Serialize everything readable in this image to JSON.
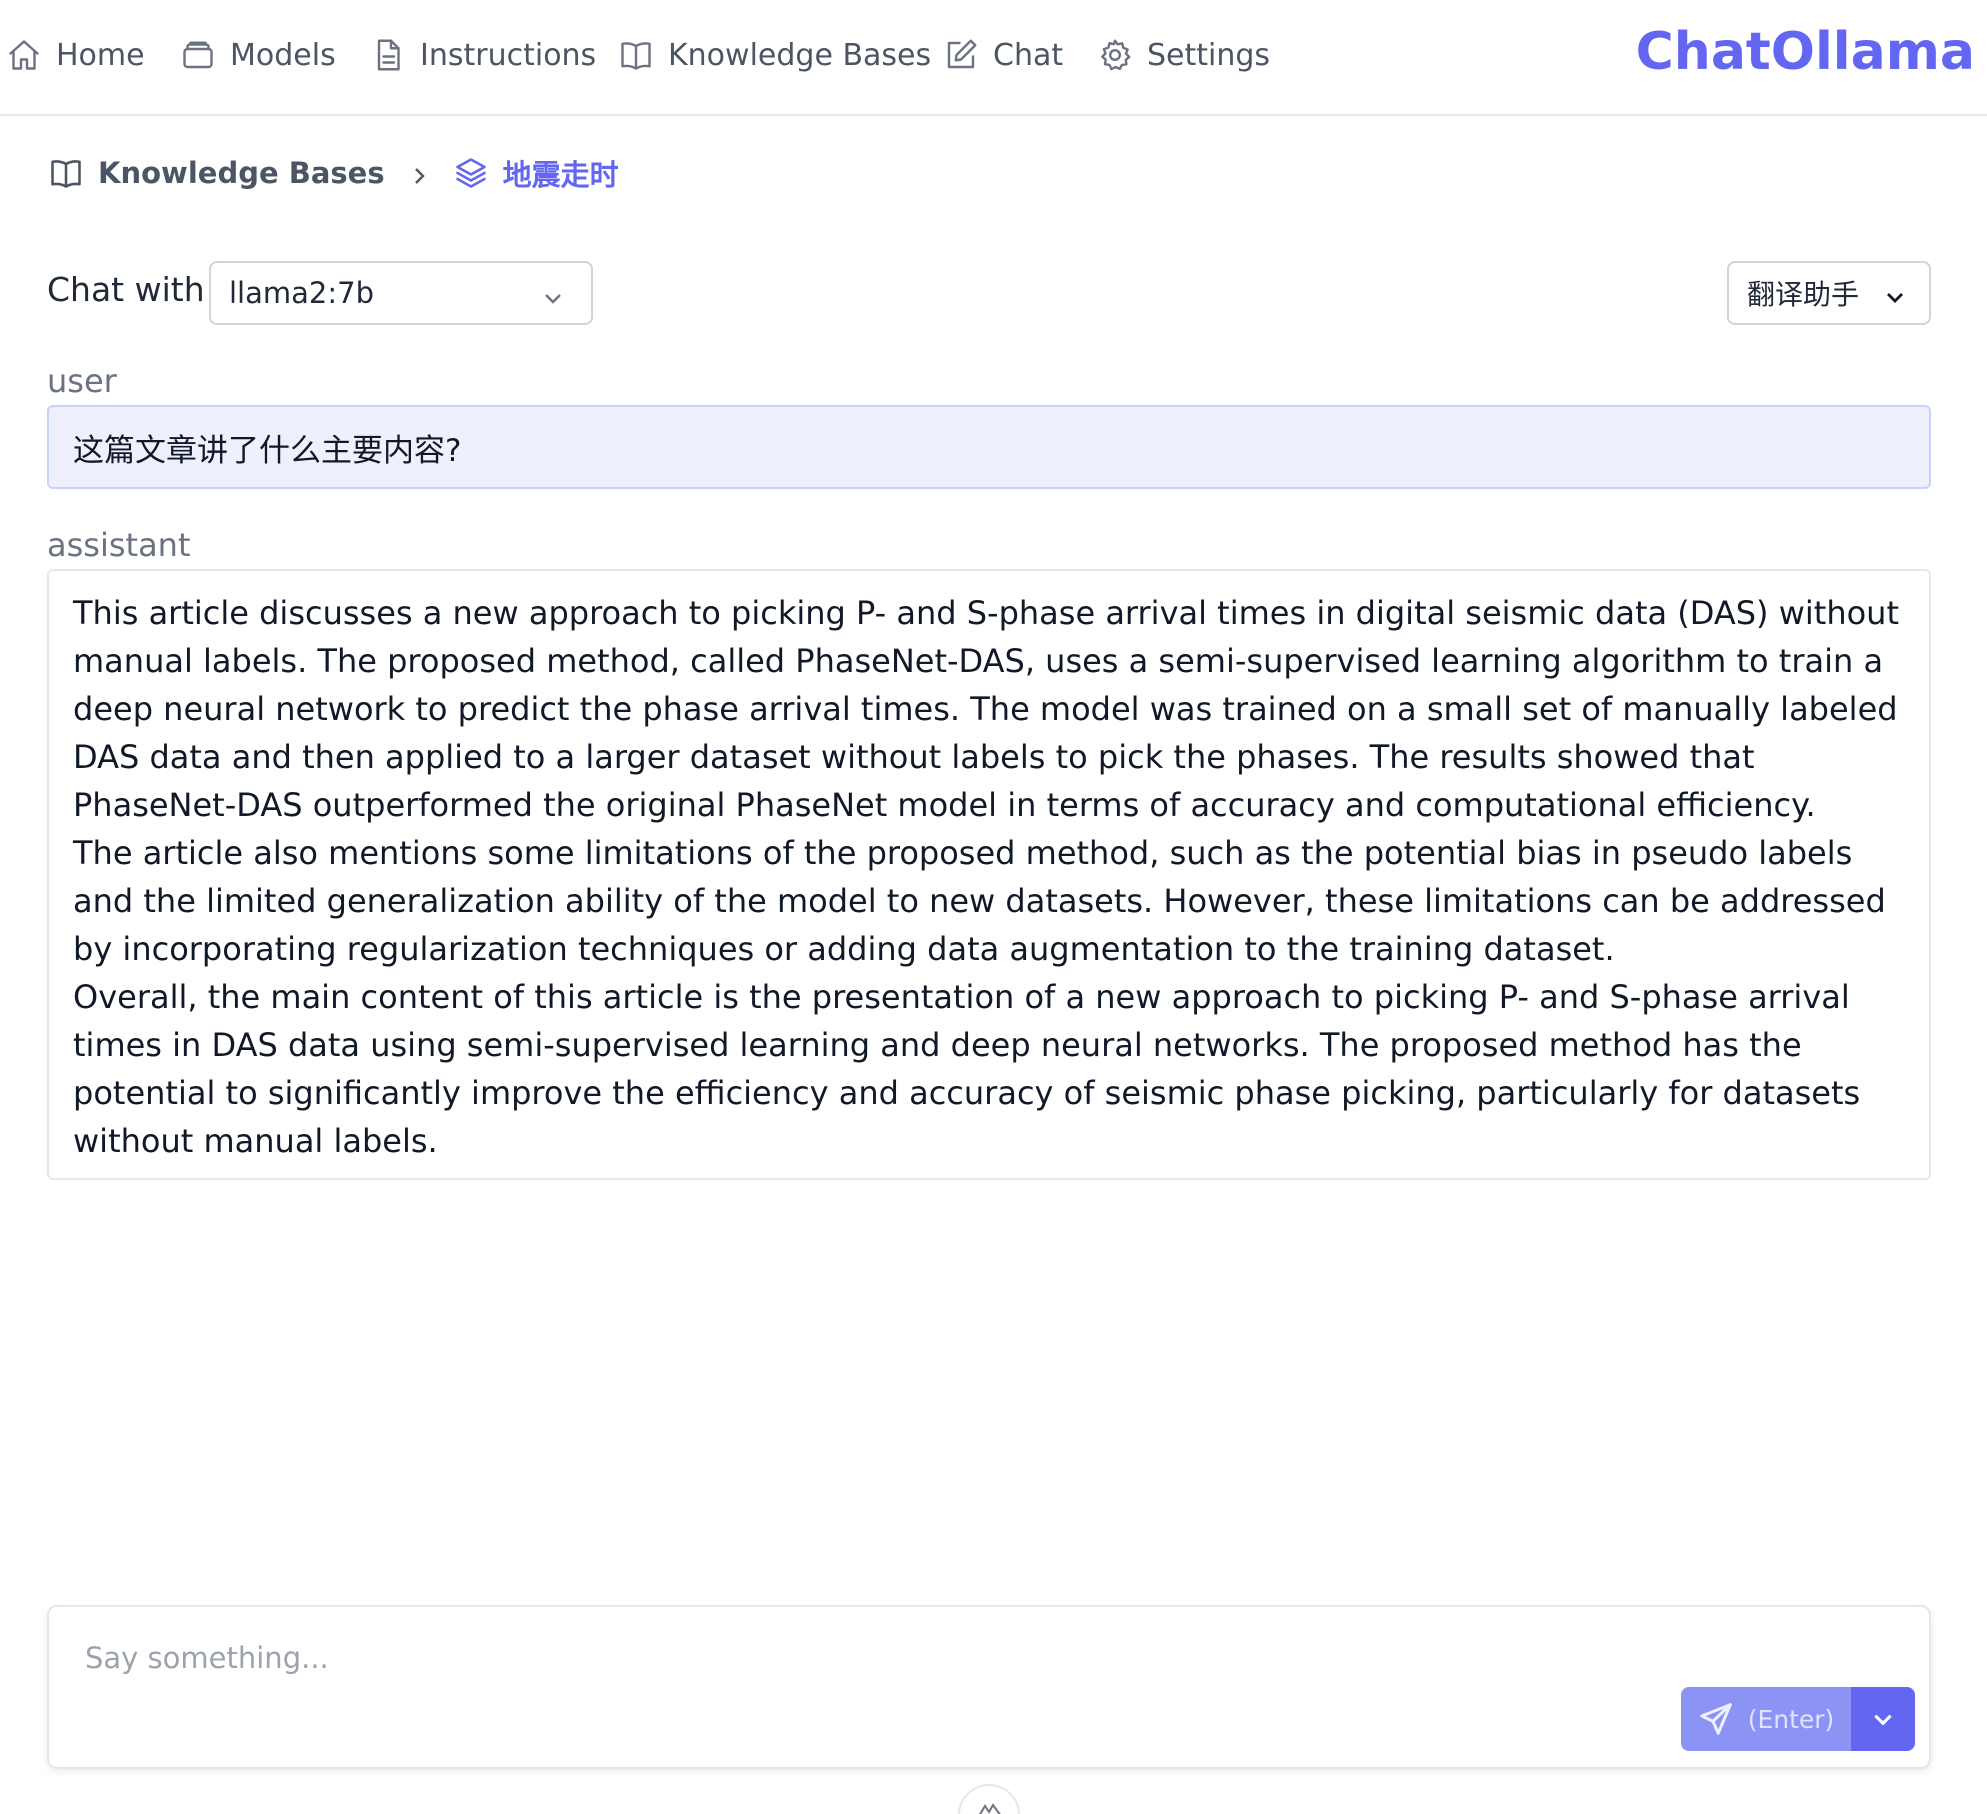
{
  "nav": {
    "items": [
      {
        "label": "Home",
        "icon": "home-icon"
      },
      {
        "label": "Models",
        "icon": "models-icon"
      },
      {
        "label": "Instructions",
        "icon": "document-icon"
      },
      {
        "label": "Knowledge Bases",
        "icon": "book-icon"
      },
      {
        "label": "Chat",
        "icon": "edit-icon"
      },
      {
        "label": "Settings",
        "icon": "gear-icon"
      }
    ],
    "brand": "ChatOllama"
  },
  "breadcrumb": {
    "parent": "Knowledge Bases",
    "current": "地震走时"
  },
  "chat": {
    "chat_with_label": "Chat with",
    "model": "llama2:7b",
    "instruction": "翻译助手",
    "messages": [
      {
        "role": "user",
        "content": "这篇文章讲了什么主要内容?"
      },
      {
        "role": "assistant",
        "paragraphs": [
          "This article discusses a new approach to picking P- and S-phase arrival times in digital seismic data (DAS) without manual labels. The proposed method, called PhaseNet-DAS, uses a semi-supervised learning algorithm to train a deep neural network to predict the phase arrival times. The model was trained on a small set of manually labeled DAS data and then applied to a larger dataset without labels to pick the phases. The results showed that PhaseNet-DAS outperformed the original PhaseNet model in terms of accuracy and computational efficiency.",
          "The article also mentions some limitations of the proposed method, such as the potential bias in pseudo labels and the limited generalization ability of the model to new datasets. However, these limitations can be addressed by incorporating regularization techniques or adding data augmentation to the training dataset.",
          "Overall, the main content of this article is the presentation of a new approach to picking P- and S-phase arrival times in DAS data using semi-supervised learning and deep neural networks. The proposed method has the potential to significantly improve the efficiency and accuracy of seismic phase picking, particularly for datasets without manual labels."
        ]
      }
    ]
  },
  "input": {
    "placeholder": "Say something...",
    "value": "",
    "send_label": "(Enter)"
  },
  "colors": {
    "accent": "#6366f1",
    "send_button": "#8b93f4",
    "user_bubble": "#eef0fd"
  }
}
